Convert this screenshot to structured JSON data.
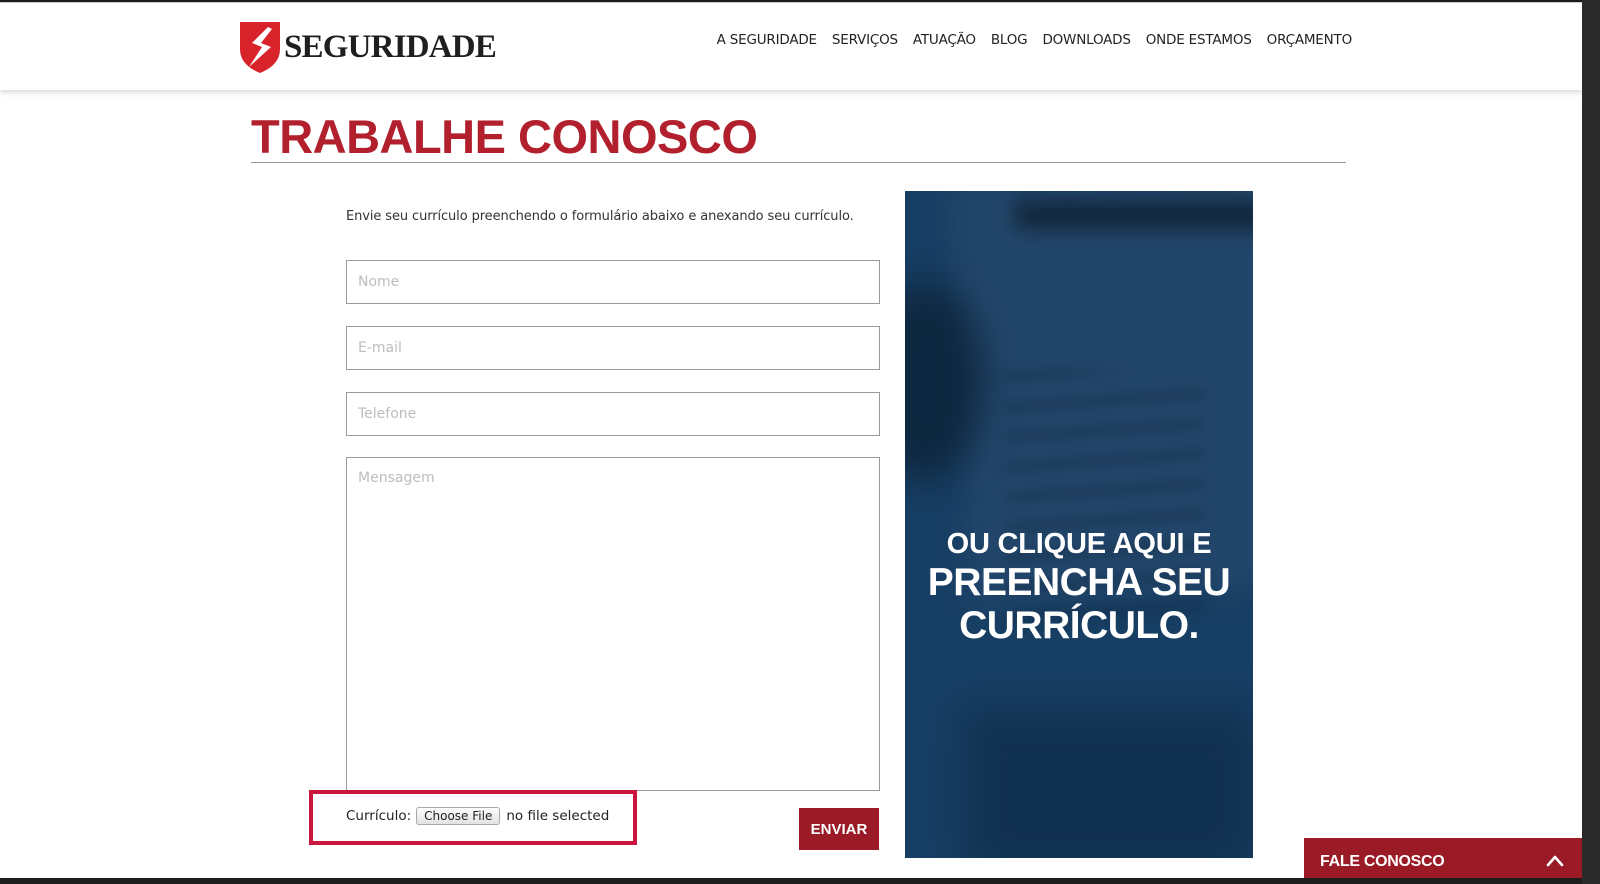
{
  "header": {
    "logo_text": "SEGURIDADE",
    "nav": [
      "A SEGURIDADE",
      "SERVIÇOS",
      "ATUAÇÃO",
      "BLOG",
      "DOWNLOADS",
      "ONDE ESTAMOS",
      "ORÇAMENTO"
    ]
  },
  "page": {
    "title": "TRABALHE CONOSCO",
    "intro": "Envie seu currículo preenchendo o formulário abaixo e anexando seu currículo."
  },
  "form": {
    "name_placeholder": "Nome",
    "email_placeholder": "E-mail",
    "phone_placeholder": "Telefone",
    "message_placeholder": "Mensagem",
    "file_label": "Currículo:",
    "choose_file": "Choose File",
    "no_file": "no file selected",
    "submit": "ENVIAR"
  },
  "banner": {
    "line1": "OU CLIQUE AQUI E",
    "line2": "PREENCHA SEU",
    "line3": "CURRÍCULO."
  },
  "contact_widget": {
    "label": "FALE CONOSCO"
  },
  "colors": {
    "brand_red": "#b21f2d",
    "button_red": "#9a1b25",
    "highlight": "#c8163d",
    "banner_blue": "#173e63"
  },
  "icons": {
    "logo": "shield-s-icon",
    "widget_toggle": "chevron-up-icon"
  }
}
